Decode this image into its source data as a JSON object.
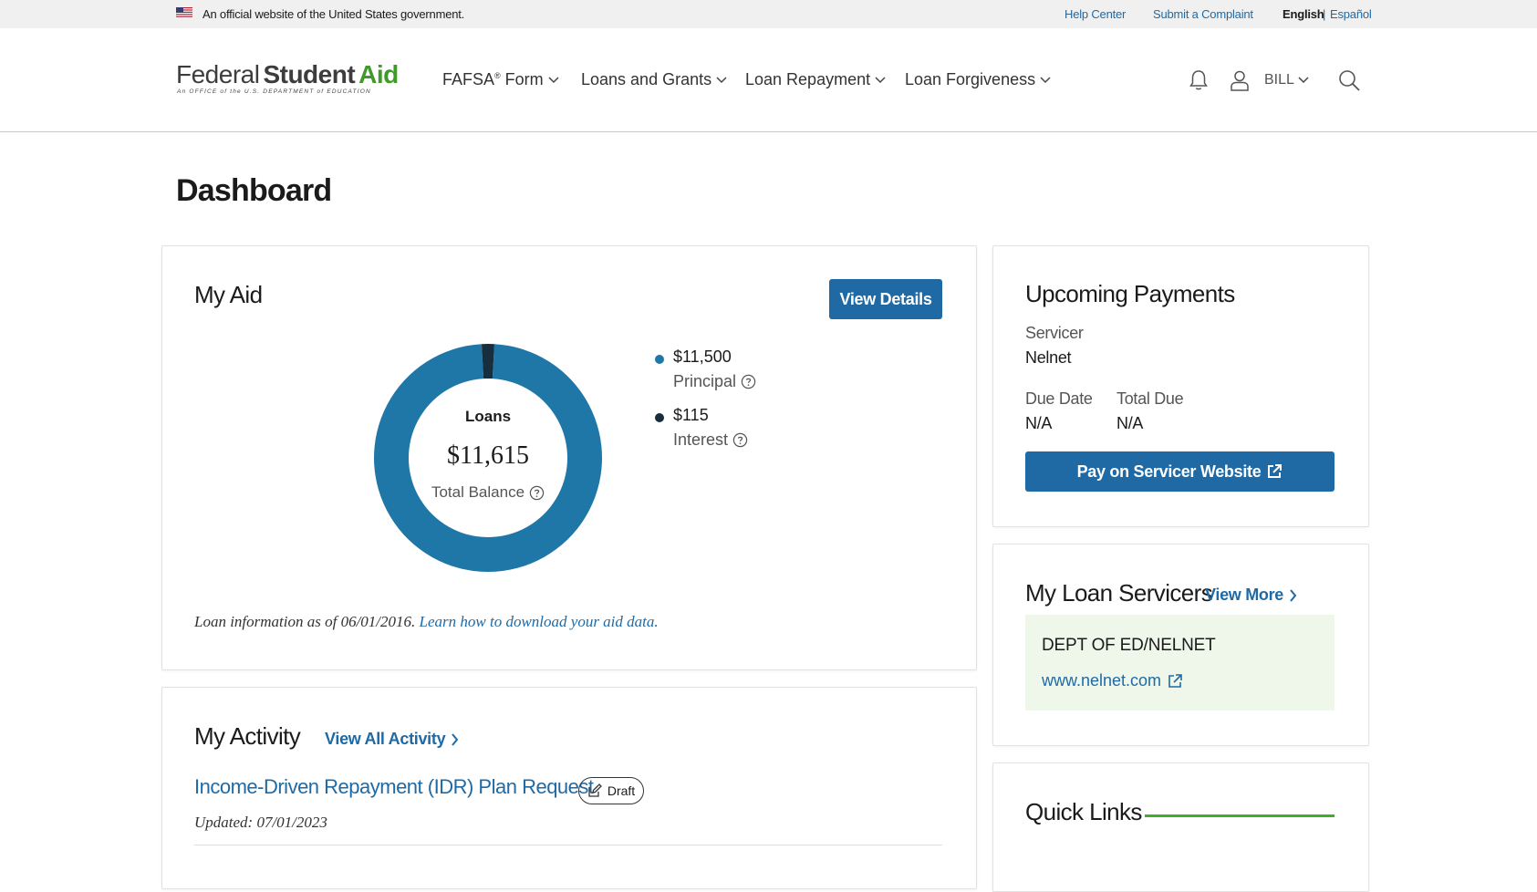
{
  "gov_banner": {
    "official_text": "An official website of the United States government.",
    "help_center": "Help Center",
    "submit_complaint": "Submit a Complaint",
    "english": "English",
    "separator": "|",
    "espanol": "Español"
  },
  "header": {
    "logo": {
      "word1": "Federal",
      "word2": "Student",
      "word3": "Aid",
      "subtitle": "An OFFICE of the U.S. DEPARTMENT of EDUCATION"
    },
    "nav": [
      {
        "label": "FAFSA",
        "sup": "®",
        "suffix": " Form"
      },
      {
        "label": "Loans and Grants"
      },
      {
        "label": "Loan Repayment"
      },
      {
        "label": "Loan Forgiveness"
      }
    ],
    "user_name": "BILL",
    "icons": [
      "bell-icon",
      "user-icon",
      "search-icon"
    ]
  },
  "page": {
    "title": "Dashboard"
  },
  "my_aid": {
    "title": "My Aid",
    "view_details": "View Details",
    "donut": {
      "label": "Loans",
      "total": "$11,615",
      "sub": "Total Balance"
    },
    "legend": [
      {
        "amount": "$11,500",
        "label": "Principal",
        "color": "#1f77a8"
      },
      {
        "amount": "$115",
        "label": "Interest",
        "color": "#162e3d"
      }
    ],
    "note_prefix": "Loan information as of 06/01/2016.",
    "note_link": "Learn how to download your aid data."
  },
  "chart_data": {
    "type": "pie",
    "categories": [
      "Principal",
      "Interest"
    ],
    "values": [
      11500,
      115
    ],
    "colors": [
      "#1f77a8",
      "#162e3d"
    ],
    "title": ""
  },
  "my_activity": {
    "title": "My Activity",
    "view_all": "View All Activity",
    "items": [
      {
        "title": "Income-Driven Repayment (IDR) Plan Request",
        "badge": "Draft",
        "updated": "Updated: 07/01/2023"
      }
    ]
  },
  "upcoming_payments": {
    "title": "Upcoming Payments",
    "servicer_label": "Servicer",
    "servicer_value": "Nelnet",
    "due_date_label": "Due Date",
    "due_date_value": "N/A",
    "total_due_label": "Total Due",
    "total_due_value": "N/A",
    "pay_button": "Pay on Servicer Website"
  },
  "loan_servicers": {
    "title": "My Loan Servicers",
    "view_more": "View More",
    "servicers": [
      {
        "name": "DEPT OF ED/NELNET",
        "url": "www.nelnet.com"
      }
    ]
  },
  "quick_links": {
    "title": "Quick Links"
  },
  "colors": {
    "primary": "#1f6aa5",
    "accent_green": "#3fae2a",
    "servicer_bg": "#eef7ea"
  }
}
